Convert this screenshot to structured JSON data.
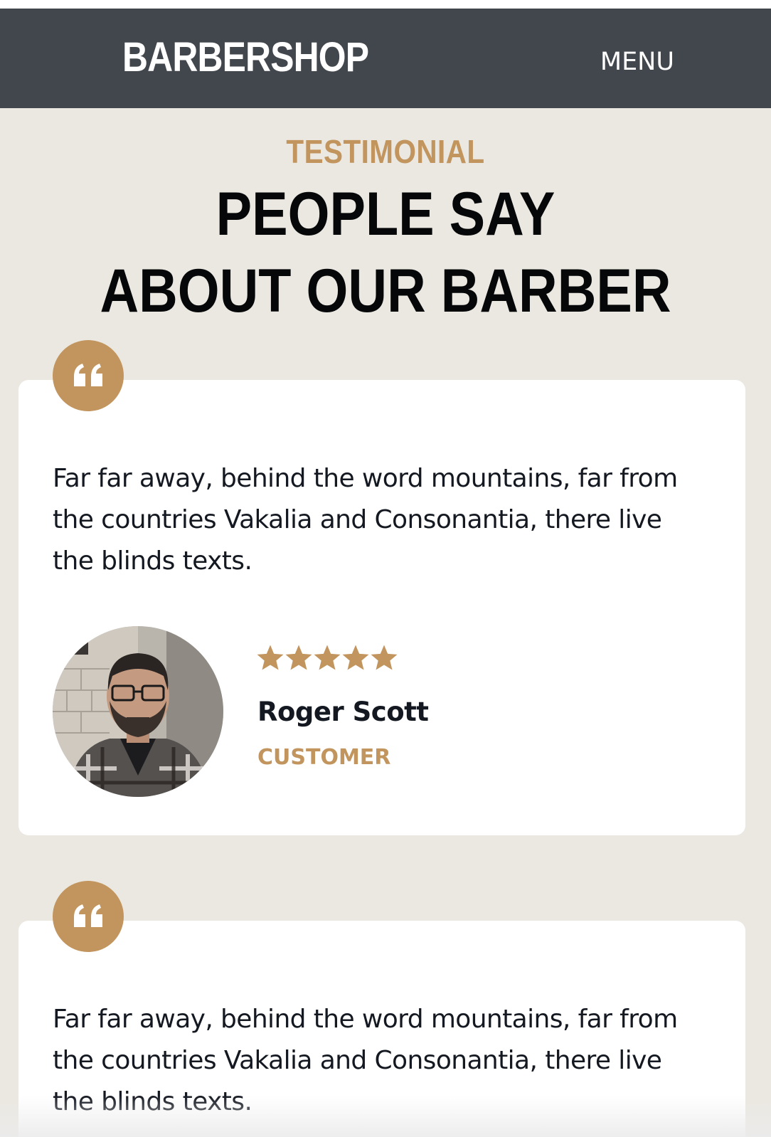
{
  "header": {
    "brand": "BARBERSHOP",
    "menu_label": "MENU"
  },
  "section": {
    "eyebrow": "TESTIMONIAL",
    "heading_line1": "PEOPLE SAY",
    "heading_line2": "ABOUT OUR BARBER"
  },
  "testimonials": [
    {
      "quote": "Far far away, behind the word mountains, far from the countries Vakalia and Consonantia, there live the blinds texts.",
      "rating": 5,
      "rating_max": 5,
      "name": "Roger Scott",
      "role": "CUSTOMER"
    },
    {
      "quote": "Far far away, behind the word mountains, far from the countries Vakalia and Consonantia, there live the blinds texts."
    }
  ],
  "colors": {
    "accent": "#c2955e",
    "nav_bg": "#42464d",
    "page_bg": "#ebe8e1",
    "card_bg": "#ffffff"
  },
  "icons": {
    "quote_badge": "quote-left-icon",
    "rating_star": "star-icon"
  }
}
